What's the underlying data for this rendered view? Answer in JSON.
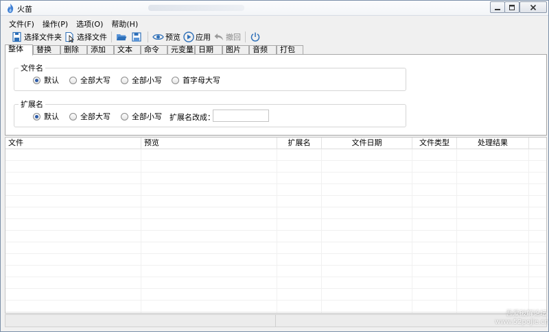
{
  "window": {
    "title": "火苗"
  },
  "menu": [
    {
      "label": "文件(F)"
    },
    {
      "label": "操作(P)"
    },
    {
      "label": "选项(O)"
    },
    {
      "label": "帮助(H)"
    }
  ],
  "toolbar": {
    "select_folder": "选择文件夹",
    "select_file": "选择文件",
    "preview": "预览",
    "apply": "应用",
    "undo": "撤回"
  },
  "tabs": [
    "整体",
    "替换",
    "删除",
    "添加",
    "文本",
    "命令",
    "元变量",
    "日期",
    "图片",
    "音频",
    "打包"
  ],
  "filename_group": {
    "label": "文件名",
    "options": [
      "默认",
      "全部大写",
      "全部小写",
      "首字母大写"
    ],
    "selected": 0
  },
  "extension_group": {
    "label": "扩展名",
    "options": [
      "默认",
      "全部大写",
      "全部小写"
    ],
    "selected": 0,
    "change_label": "扩展名改成：",
    "change_value": ""
  },
  "grid": {
    "columns": [
      "文件",
      "预览",
      "扩展名",
      "文件日期",
      "文件类型",
      "处理结果"
    ]
  },
  "watermark": {
    "line1": "吾爱破解论坛",
    "line2": "www.52pojie.cn"
  },
  "colors": {
    "accent": "#2a5aa8",
    "border": "#a7a7a7"
  }
}
